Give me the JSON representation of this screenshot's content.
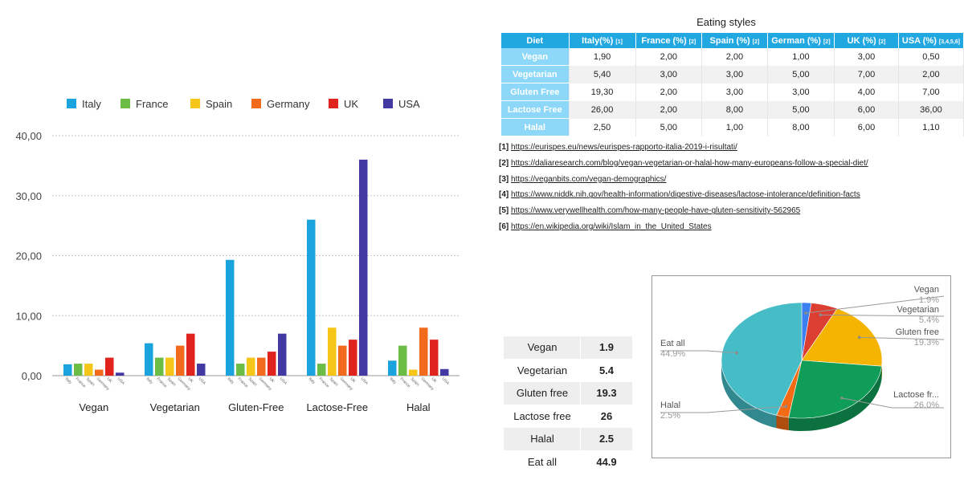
{
  "chart_data": [
    {
      "type": "bar",
      "categories": [
        "Vegan",
        "Vegetarian",
        "Gluten-Free",
        "Lactose-Free",
        "Halal"
      ],
      "tick_labels": [
        "Italy",
        "France",
        "Spain",
        "Germany",
        "UK",
        "USA"
      ],
      "series": [
        {
          "name": "Italy",
          "color": "#1aa3dc",
          "values": [
            1.9,
            5.4,
            19.3,
            26.0,
            2.5
          ]
        },
        {
          "name": "France",
          "color": "#6bbd45",
          "values": [
            2.0,
            3.0,
            2.0,
            2.0,
            5.0
          ]
        },
        {
          "name": "Spain",
          "color": "#f5c518",
          "values": [
            2.0,
            3.0,
            3.0,
            8.0,
            1.0
          ]
        },
        {
          "name": "Germany",
          "color": "#f26b1d",
          "values": [
            1.0,
            5.0,
            3.0,
            5.0,
            8.0
          ]
        },
        {
          "name": "UK",
          "color": "#e0231c",
          "values": [
            3.0,
            7.0,
            4.0,
            6.0,
            6.0
          ]
        },
        {
          "name": "USA",
          "color": "#4339a3",
          "values": [
            0.5,
            2.0,
            7.0,
            36.0,
            1.1
          ]
        }
      ],
      "yticks": [
        "0,00",
        "10,00",
        "20,00",
        "30,00",
        "40,00"
      ],
      "ylim": [
        0,
        40
      ],
      "grid": true,
      "legend": "top"
    },
    {
      "type": "pie",
      "slices": [
        {
          "name": "Vegan",
          "pct": "1.9%",
          "value": 1.9,
          "color": "#3b7ff0"
        },
        {
          "name": "Vegetarian",
          "pct": "5.4%",
          "value": 5.4,
          "color": "#dc3f31"
        },
        {
          "name": "Gluten free",
          "pct": "19.3%",
          "value": 19.3,
          "color": "#f4b400"
        },
        {
          "name": "Lactose fr...",
          "pct": "26.0%",
          "value": 26.0,
          "color": "#0f9d58"
        },
        {
          "name": "Halal",
          "pct": "2.5%",
          "value": 2.5,
          "color": "#f36b14"
        },
        {
          "name": "Eat all",
          "pct": "44.9%",
          "value": 44.9,
          "color": "#46bdc6"
        }
      ],
      "style": "3d"
    }
  ],
  "styles_table": {
    "title": "Eating styles",
    "headers": [
      {
        "label": "Diet",
        "ref": ""
      },
      {
        "label": "Italy(%)",
        "ref": "[1]"
      },
      {
        "label": "France (%)",
        "ref": "[2]"
      },
      {
        "label": "Spain (%)",
        "ref": "[2]"
      },
      {
        "label": "German (%)",
        "ref": "[2]"
      },
      {
        "label": "UK (%)",
        "ref": "[2]"
      },
      {
        "label": "USA (%)",
        "ref": "[3,4,5,6]"
      }
    ],
    "rows": [
      {
        "diet": "Vegan",
        "values": [
          "1,90",
          "2,00",
          "2,00",
          "1,00",
          "3,00",
          "0,50"
        ]
      },
      {
        "diet": "Vegetarian",
        "values": [
          "5,40",
          "3,00",
          "3,00",
          "5,00",
          "7,00",
          "2,00"
        ]
      },
      {
        "diet": "Gluten Free",
        "values": [
          "19,30",
          "2,00",
          "3,00",
          "3,00",
          "4,00",
          "7,00"
        ]
      },
      {
        "diet": "Lactose Free",
        "values": [
          "26,00",
          "2,00",
          "8,00",
          "5,00",
          "6,00",
          "36,00"
        ]
      },
      {
        "diet": "Halal",
        "values": [
          "2,50",
          "5,00",
          "1,00",
          "8,00",
          "6,00",
          "1,10"
        ]
      }
    ]
  },
  "references": [
    {
      "num": "[1]",
      "url": "https://eurispes.eu/news/eurispes-rapporto-italia-2019-i-risultati/"
    },
    {
      "num": "[2]",
      "url": "https://daliaresearch.com/blog/vegan-vegetarian-or-halal-how-many-europeans-follow-a-special-diet/"
    },
    {
      "num": "[3]",
      "url": "https://veganbits.com/vegan-demographics/"
    },
    {
      "num": "[4]",
      "url": "https://www.niddk.nih.gov/health-information/digestive-diseases/lactose-intolerance/definition-facts"
    },
    {
      "num": "[5]",
      "url": "https://www.verywellhealth.com/how-many-people-have-gluten-sensitivity-562965"
    },
    {
      "num": "[6]",
      "url": "https://en.wikipedia.org/wiki/Islam_in_the_United_States"
    }
  ],
  "summary_table": [
    {
      "label": "Vegan",
      "value": "1.9"
    },
    {
      "label": "Vegetarian",
      "value": "5.4"
    },
    {
      "label": "Gluten free",
      "value": "19.3"
    },
    {
      "label": "Lactose free",
      "value": "26"
    },
    {
      "label": "Halal",
      "value": "2.5"
    },
    {
      "label": "Eat all",
      "value": "44.9"
    }
  ]
}
